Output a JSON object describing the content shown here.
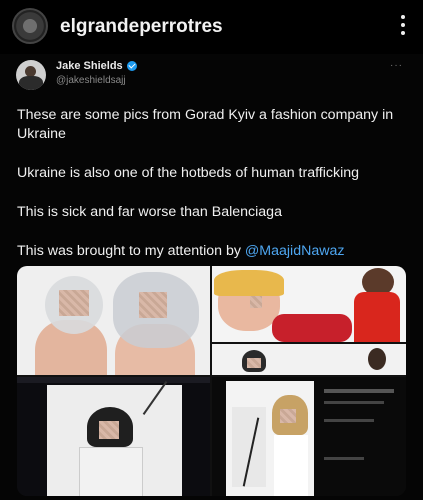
{
  "instagram": {
    "username": "elgrandeperrotres"
  },
  "tweet": {
    "name": "Jake Shields",
    "handle": "@jakeshieldsajj",
    "more": "···",
    "paragraphs": {
      "p1": "These are some pics from Gorad Kyiv a fashion company in Ukraine",
      "p2": "Ukraine is also one of the hotbeds of human trafficking",
      "p3": "This is sick and far worse than Balenciaga",
      "p4_prefix": "This was brought to my attention by ",
      "p4_mention": "@MaajidNawaz"
    }
  },
  "icons": {
    "menu": "more-vertical-icon",
    "verified": "verified-badge-icon"
  },
  "colors": {
    "background": "#000000",
    "mention": "#4ea6f0",
    "verified": "#1d9bf0"
  }
}
